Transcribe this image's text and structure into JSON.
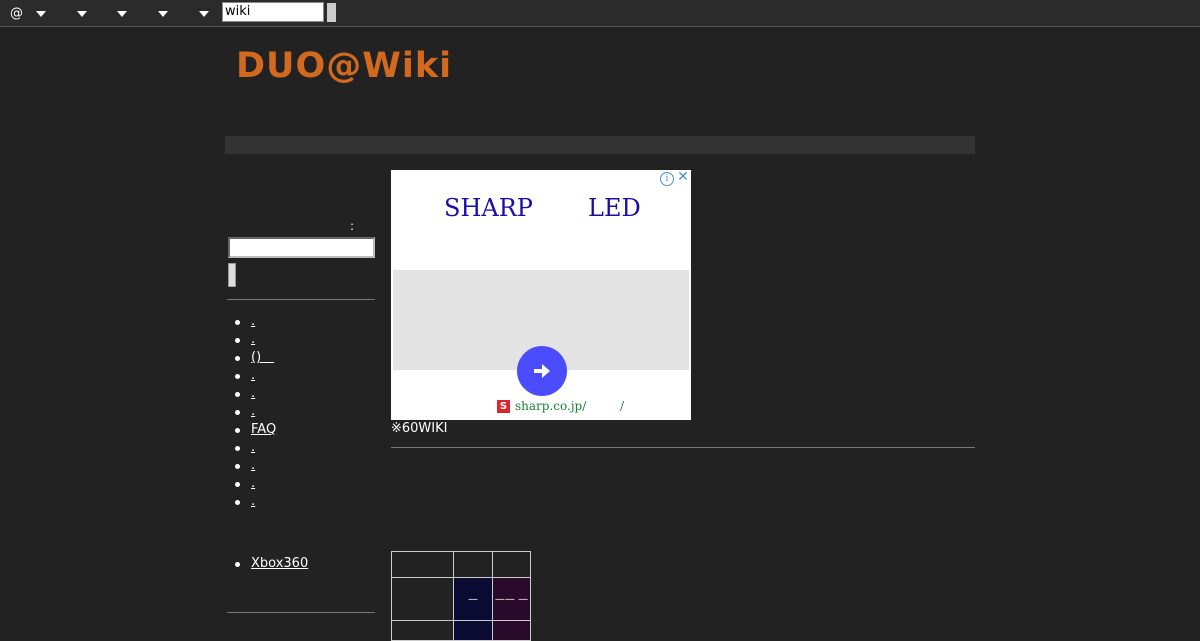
{
  "topbar": {
    "at_label": "@",
    "search_value": "wiki"
  },
  "site": {
    "title": "DUO@Wiki"
  },
  "sidebar": {
    "search_colon": ":",
    "menu": [
      {
        "label": "."
      },
      {
        "label": "."
      },
      {
        "label": "()　"
      },
      {
        "label": "."
      },
      {
        "label": "."
      },
      {
        "label": "."
      },
      {
        "label": "FAQ"
      },
      {
        "label": "."
      },
      {
        "label": "."
      },
      {
        "label": "."
      },
      {
        "label": "."
      }
    ],
    "menu2": [
      {
        "label": "Xbox360"
      }
    ]
  },
  "ad": {
    "headline_1": "SHARP",
    "headline_2": "LED",
    "url": "sharp.co.jp/",
    "url_suffix": "/",
    "logo_letter": "S",
    "colors": {
      "headline": "#1a0dab",
      "url": "#1a7f37",
      "button": "#4c4cff",
      "logo": "#d9282d"
    }
  },
  "main": {
    "notice": "※60WIKI"
  },
  "table": {
    "cells": [
      "",
      "",
      "",
      "",
      "—",
      "—— —",
      "",
      "",
      ""
    ],
    "colors": {
      "dark_blue": "#0a0a33",
      "dark_purple": "#2a0a2a"
    }
  },
  "colors": {
    "background": "#222222",
    "title": "#d2691e"
  }
}
